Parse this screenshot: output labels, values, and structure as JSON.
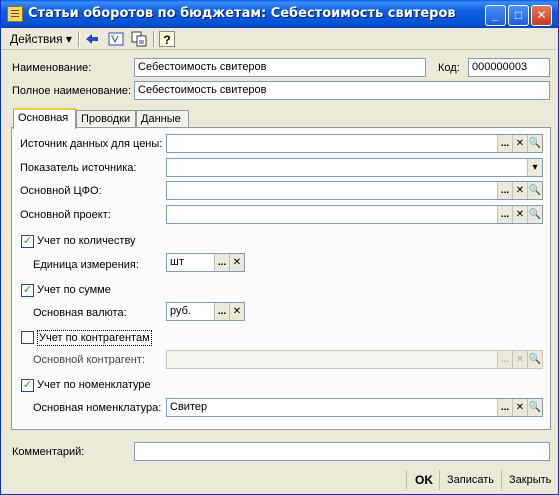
{
  "window": {
    "title": "Статьи оборотов по бюджетам: Себестоимость свитеров",
    "minimize_symbol": "_",
    "maximize_symbol": "□",
    "close_symbol": "✕"
  },
  "toolbar": {
    "actions_label": "Действия",
    "actions_arrow": "▾",
    "help_symbol": "?"
  },
  "header": {
    "name_label": "Наименование:",
    "name_value": "Себестоимость свитеров",
    "code_label": "Код:",
    "code_value": "000000003",
    "fullname_label": "Полное наименование:",
    "fullname_value": "Себестоимость свитеров"
  },
  "tabs": [
    {
      "label": "Основная",
      "active": true
    },
    {
      "label": "Проводки",
      "active": false
    },
    {
      "label": "Данные",
      "active": false
    }
  ],
  "fields": {
    "price_source_label": "Источник данных для цены:",
    "price_source_value": "",
    "source_indicator_label": "Показатель источника:",
    "source_indicator_value": "",
    "main_cfo_label": "Основной ЦФО:",
    "main_cfo_value": "",
    "main_project_label": "Основной проект:",
    "main_project_value": "",
    "by_quantity_label": "Учет по количеству",
    "by_quantity_checked": true,
    "unit_label": "Единица измерения:",
    "unit_value": "шт",
    "by_sum_label": "Учет по сумме",
    "by_sum_checked": true,
    "currency_label": "Основная валюта:",
    "currency_value": "руб.",
    "by_contractors_label": "Учет по контрагентам",
    "by_contractors_checked": false,
    "contractor_label": "Основной контрагент:",
    "contractor_value": "",
    "by_nomenclature_label": "Учет по номенклатуре",
    "by_nomenclature_checked": true,
    "nomenclature_label": "Основная номенклатура:",
    "nomenclature_value": "Свитер"
  },
  "comment": {
    "label": "Комментарий:",
    "value": ""
  },
  "buttons": {
    "select_symbol": "...",
    "clear_symbol": "✕",
    "open_symbol": "🔍",
    "dropdown_symbol": "▾",
    "check_symbol": "✓",
    "ok_label": "OK",
    "save_label": "Записать",
    "close_label": "Закрыть"
  }
}
